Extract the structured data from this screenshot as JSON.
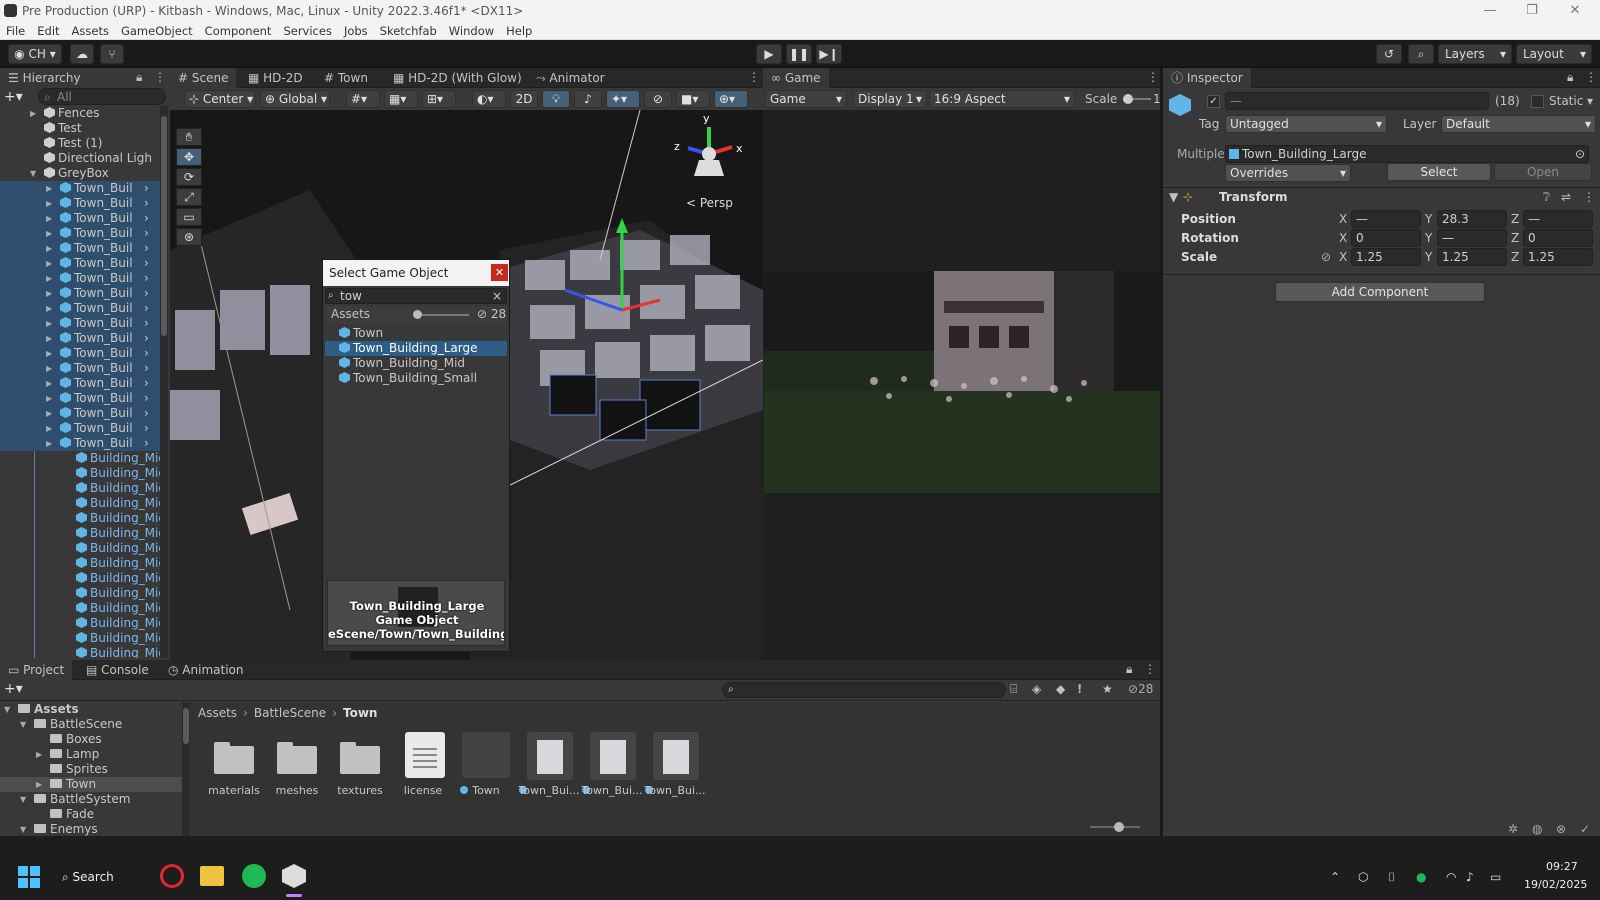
{
  "window": {
    "title": "Pre Production (URP) - Kitbash - Windows, Mac, Linux - Unity 2022.3.46f1* <DX11>",
    "minimize": "—",
    "maximize": "❐",
    "close": "✕"
  },
  "menu": [
    "File",
    "Edit",
    "Assets",
    "GameObject",
    "Component",
    "Services",
    "Jobs",
    "Sketchfab",
    "Window",
    "Help"
  ],
  "toolbar": {
    "account": "CH",
    "layers": "Layers",
    "layout": "Layout"
  },
  "hierarchy": {
    "tab": "Hierarchy",
    "search_placeholder": "All",
    "items": [
      {
        "label": "Fences",
        "kind": "gray",
        "indent": 1,
        "arrow": "▶"
      },
      {
        "label": "Test",
        "kind": "gray",
        "indent": 1,
        "arrow": ""
      },
      {
        "label": "Test (1)",
        "kind": "gray",
        "indent": 1,
        "arrow": ""
      },
      {
        "label": "Directional Ligh",
        "kind": "gray",
        "indent": 1,
        "arrow": ""
      },
      {
        "label": "GreyBox",
        "kind": "gray",
        "indent": 1,
        "arrow": "▼"
      },
      {
        "label": "Town_Buil",
        "kind": "blue",
        "indent": 2,
        "arrow": "▶"
      },
      {
        "label": "Town_Buil",
        "kind": "blue",
        "indent": 2,
        "arrow": "▶"
      },
      {
        "label": "Town_Buil",
        "kind": "blue",
        "indent": 2,
        "arrow": "▶"
      },
      {
        "label": "Town_Buil",
        "kind": "blue",
        "indent": 2,
        "arrow": "▶"
      },
      {
        "label": "Town_Buil",
        "kind": "blue",
        "indent": 2,
        "arrow": "▶"
      },
      {
        "label": "Town_Buil",
        "kind": "blue",
        "indent": 2,
        "arrow": "▶"
      },
      {
        "label": "Town_Buil",
        "kind": "blue",
        "indent": 2,
        "arrow": "▶"
      },
      {
        "label": "Town_Buil",
        "kind": "blue",
        "indent": 2,
        "arrow": "▶"
      },
      {
        "label": "Town_Buil",
        "kind": "blue",
        "indent": 2,
        "arrow": "▶"
      },
      {
        "label": "Town_Buil",
        "kind": "blue",
        "indent": 2,
        "arrow": "▶"
      },
      {
        "label": "Town_Buil",
        "kind": "blue",
        "indent": 2,
        "arrow": "▶"
      },
      {
        "label": "Town_Buil",
        "kind": "blue",
        "indent": 2,
        "arrow": "▶"
      },
      {
        "label": "Town_Buil",
        "kind": "blue",
        "indent": 2,
        "arrow": "▶"
      },
      {
        "label": "Town_Buil",
        "kind": "blue",
        "indent": 2,
        "arrow": "▶"
      },
      {
        "label": "Town_Buil",
        "kind": "blue",
        "indent": 2,
        "arrow": "▶"
      },
      {
        "label": "Town_Buil",
        "kind": "blue",
        "indent": 2,
        "arrow": "▶"
      },
      {
        "label": "Town_Buil",
        "kind": "blue",
        "indent": 2,
        "arrow": "▶"
      },
      {
        "label": "Town_Buil",
        "kind": "blue",
        "indent": 2,
        "arrow": "▶"
      },
      {
        "label": "Building_Mid",
        "kind": "prefab",
        "indent": 3,
        "arrow": ""
      },
      {
        "label": "Building_Mid",
        "kind": "prefab",
        "indent": 3,
        "arrow": ""
      },
      {
        "label": "Building_Mid",
        "kind": "prefab",
        "indent": 3,
        "arrow": ""
      },
      {
        "label": "Building_Mid",
        "kind": "prefab",
        "indent": 3,
        "arrow": ""
      },
      {
        "label": "Building_Mid",
        "kind": "prefab",
        "indent": 3,
        "arrow": ""
      },
      {
        "label": "Building_Mid",
        "kind": "prefab",
        "indent": 3,
        "arrow": ""
      },
      {
        "label": "Building_Mid",
        "kind": "prefab",
        "indent": 3,
        "arrow": ""
      },
      {
        "label": "Building_Mid",
        "kind": "prefab",
        "indent": 3,
        "arrow": ""
      },
      {
        "label": "Building_Mid",
        "kind": "prefab",
        "indent": 3,
        "arrow": ""
      },
      {
        "label": "Building_Mid",
        "kind": "prefab",
        "indent": 3,
        "arrow": ""
      },
      {
        "label": "Building_Mid",
        "kind": "prefab",
        "indent": 3,
        "arrow": ""
      },
      {
        "label": "Building_Mid",
        "kind": "prefab",
        "indent": 3,
        "arrow": ""
      },
      {
        "label": "Building_Mid",
        "kind": "prefab",
        "indent": 3,
        "arrow": ""
      },
      {
        "label": "Building_Mid",
        "kind": "prefab",
        "indent": 3,
        "arrow": ""
      }
    ]
  },
  "scene_tabs": [
    "Scene",
    "HD-2D",
    "Town",
    "HD-2D (With Glow)",
    "Animator"
  ],
  "scene_toolbar": {
    "pivot": "Center",
    "space": "Global",
    "mode2d": "2D"
  },
  "gizmo": {
    "persp": "< Persp",
    "x": "x",
    "y": "y",
    "z": "z"
  },
  "game": {
    "tab": "Game",
    "mode": "Game",
    "display": "Display 1",
    "aspect": "16:9 Aspect",
    "scale_label": "Scale",
    "scale_value": "1"
  },
  "select_dialog": {
    "title": "Select Game Object",
    "search": "tow",
    "filter": "Assets",
    "count": "28",
    "items": [
      "Town",
      "Town_Building_Large",
      "Town_Building_Mid",
      "Town_Building_Small"
    ],
    "selected_index": 1,
    "preview": [
      "Town_Building_Large",
      "Game Object",
      "eScene/Town/Town_Building_l"
    ]
  },
  "inspector": {
    "tab": "Inspector",
    "name": "—",
    "count": "(18)",
    "static": "Static",
    "tag_label": "Tag",
    "tag": "Untagged",
    "layer_label": "Layer",
    "layer": "Default",
    "multiple_label": "Multiple",
    "multiple_value": "Town_Building_Large",
    "overrides": "Overrides",
    "select_btn": "Select",
    "open_btn": "Open",
    "component": "Transform",
    "rows": [
      {
        "label": "Position",
        "x": "—",
        "y": "28.3",
        "z": "—"
      },
      {
        "label": "Rotation",
        "x": "0",
        "y": "—",
        "z": "0"
      },
      {
        "label": "Scale",
        "x": "1.25",
        "y": "1.25",
        "z": "1.25"
      }
    ],
    "add_component": "Add Component"
  },
  "project": {
    "tabs": [
      "Project",
      "Console",
      "Animation"
    ],
    "count": "28",
    "breadcrumb": [
      "Assets",
      "BattleScene",
      "Town"
    ],
    "tree": [
      {
        "label": "Assets",
        "indent": 0,
        "arrow": "▼",
        "bold": true
      },
      {
        "label": "BattleScene",
        "indent": 1,
        "arrow": "▼",
        "bold": false
      },
      {
        "label": "Boxes",
        "indent": 2,
        "arrow": "",
        "bold": false
      },
      {
        "label": "Lamp",
        "indent": 2,
        "arrow": "▶",
        "bold": false
      },
      {
        "label": "Sprites",
        "indent": 2,
        "arrow": "",
        "bold": false
      },
      {
        "label": "Town",
        "indent": 2,
        "arrow": "▶",
        "bold": false
      },
      {
        "label": "BattleSystem",
        "indent": 1,
        "arrow": "▼",
        "bold": false
      },
      {
        "label": "Fade",
        "indent": 2,
        "arrow": "",
        "bold": false
      },
      {
        "label": "Enemys",
        "indent": 1,
        "arrow": "▼",
        "bold": false
      }
    ],
    "tree_selected": 5,
    "assets": [
      {
        "label": "materials",
        "type": "folder"
      },
      {
        "label": "meshes",
        "type": "folder"
      },
      {
        "label": "textures",
        "type": "folder"
      },
      {
        "label": "license",
        "type": "file"
      },
      {
        "label": "Town",
        "type": "scene"
      },
      {
        "label": "Town_Bui...",
        "type": "building"
      },
      {
        "label": "Town_Bui...",
        "type": "building"
      },
      {
        "label": "Town_Bui...",
        "type": "building"
      }
    ]
  },
  "taskbar": {
    "search": "Search",
    "time": "09:27",
    "date": "19/02/2025"
  }
}
